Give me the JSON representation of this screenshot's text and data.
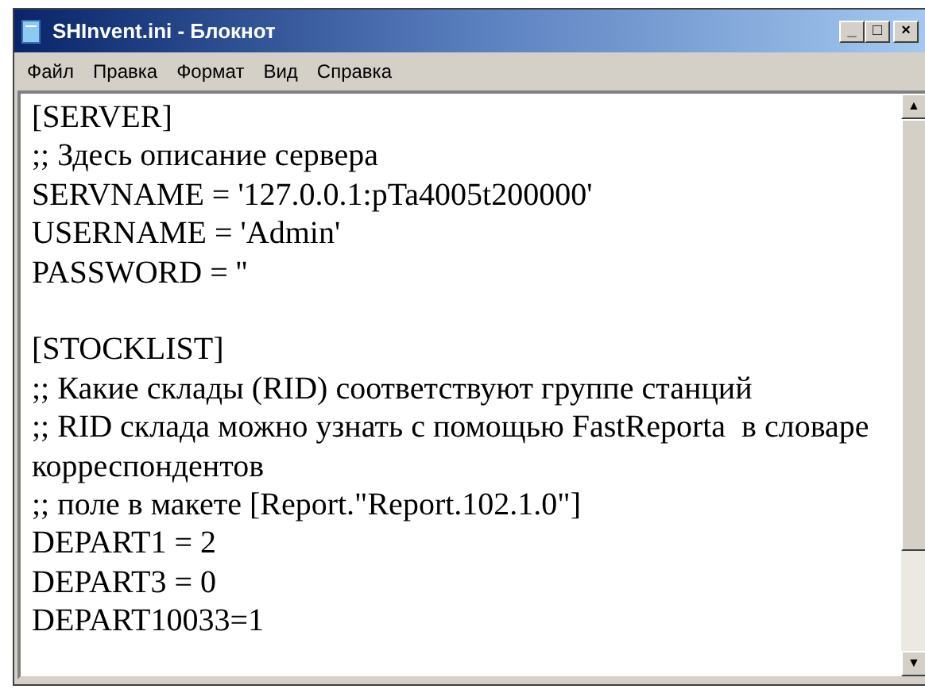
{
  "window": {
    "title": "SHInvent.ini - Блокнот",
    "controls": [
      "_",
      "□",
      "×"
    ]
  },
  "menu": [
    {
      "label": "Файл"
    },
    {
      "label": "Правка"
    },
    {
      "label": "Формат"
    },
    {
      "label": "Вид"
    },
    {
      "label": "Справка"
    }
  ],
  "editor": {
    "sections": [
      {
        "lines": [
          "[SERVER]",
          ";; Здесь описание сервера",
          "SERVNAME = '127.0.0.1:pTa4005t200000'",
          "USERNAME = 'Admin'",
          "PASSWORD = ''"
        ]
      },
      {
        "lines": [
          "[STOCKLIST]",
          ";; Какие склады (RID) соответствуют группе станций",
          ";; RID склада можно узнать с помощью FastReporta  в словаре корреспондентов",
          ";; поле в макете [Report.\"Report.102.1.0\"]",
          "DEPART1 = 2",
          "DEPART3 = 0",
          "DEPART10033=1"
        ]
      }
    ],
    "scrollbar": {
      "up": "▲",
      "down": "▼"
    }
  }
}
